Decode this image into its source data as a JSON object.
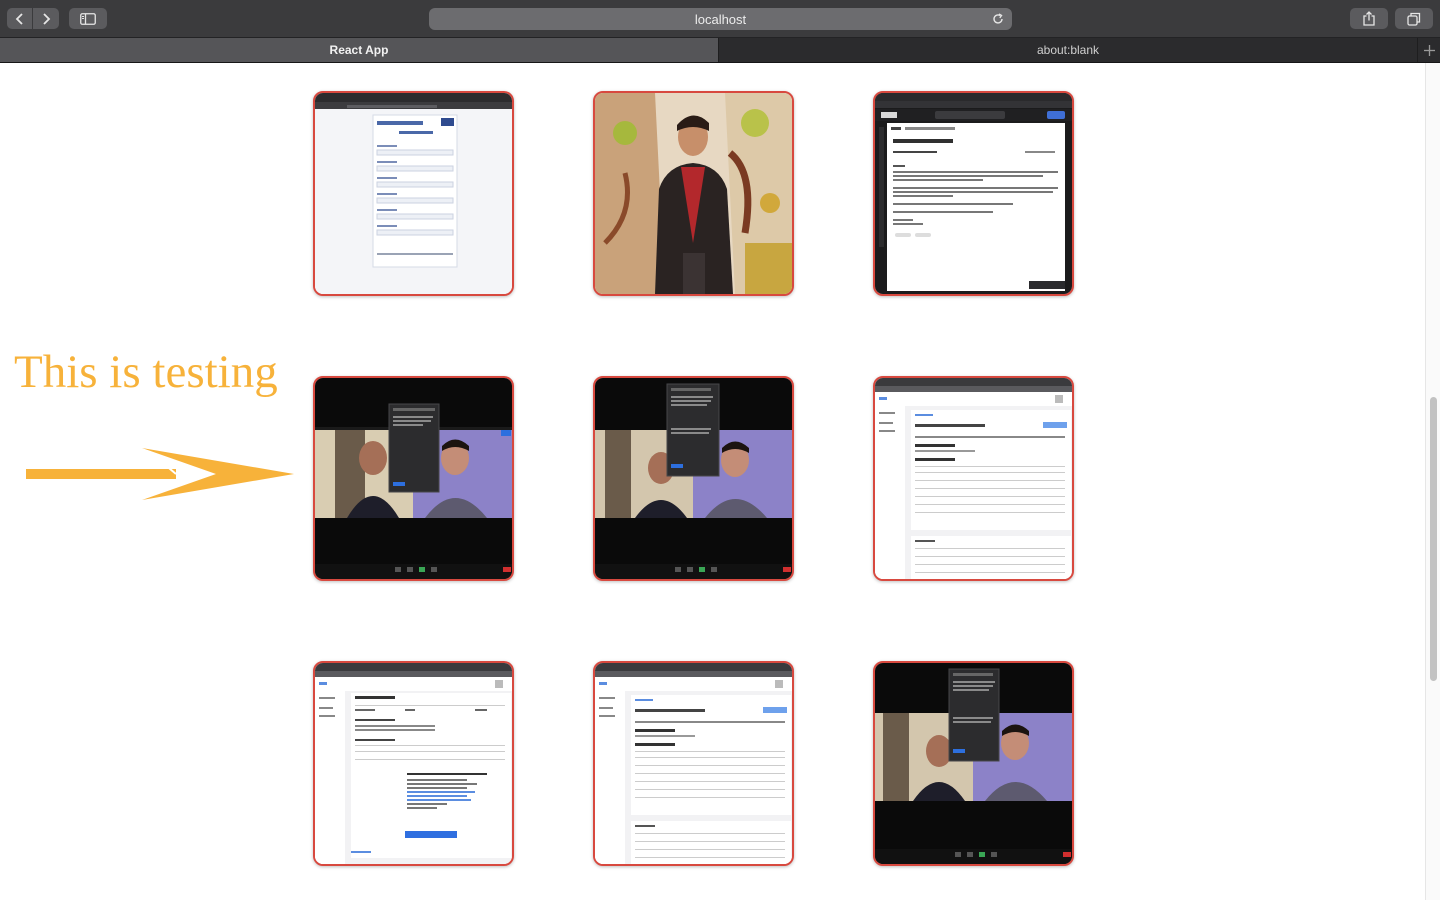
{
  "browser": {
    "address": "localhost",
    "tabs": [
      {
        "label": "React App",
        "active": true
      },
      {
        "label": "about:blank",
        "active": false
      }
    ]
  },
  "page": {
    "annotation_text": "This is testing",
    "annotation_color": "#f7b23a",
    "card_border_color": "#d8493f",
    "gallery": [
      {
        "kind": "form-screenshot"
      },
      {
        "kind": "portrait-photo"
      },
      {
        "kind": "email-screenshot"
      },
      {
        "kind": "video-call-screenshot"
      },
      {
        "kind": "video-call-screenshot"
      },
      {
        "kind": "web-table-screenshot"
      },
      {
        "kind": "course-selection-screenshot"
      },
      {
        "kind": "web-table-screenshot"
      },
      {
        "kind": "video-call-screenshot"
      }
    ]
  }
}
